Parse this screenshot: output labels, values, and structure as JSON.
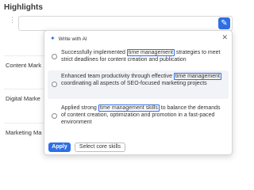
{
  "section": {
    "title": "Highlights"
  },
  "editor": {
    "ai_button_icon": "magic-wand-icon"
  },
  "rows": [
    {
      "label": "Content Mark",
      "delete_icon": "trash-icon"
    },
    {
      "label": "Digital Marke",
      "delete_icon": "trash-icon"
    },
    {
      "label": "Marketing Ma",
      "delete_icon": "trash-icon"
    }
  ],
  "popup": {
    "title": "Write with AI",
    "title_icon": "sparkle-icon",
    "close_icon": "close-icon",
    "suggestions": [
      {
        "before": "Successfully implemented ",
        "highlight": "time management",
        "after": " strategies to meet strict deadlines for content creation and publication"
      },
      {
        "before": "Enhanced team productivity through effective ",
        "highlight": "time management",
        "after": " coordinating all aspects of SEO-focused marketing projects"
      },
      {
        "before": "Applied strong ",
        "highlight": "time management skills",
        "after": " to balance the demands of content creation, optimization and promotion in a fast-paced environment"
      }
    ],
    "apply_label": "Apply",
    "core_skills_label": "Select core skills"
  },
  "colors": {
    "accent": "#2f6fe4",
    "row_alt": "#f1f3f7"
  }
}
